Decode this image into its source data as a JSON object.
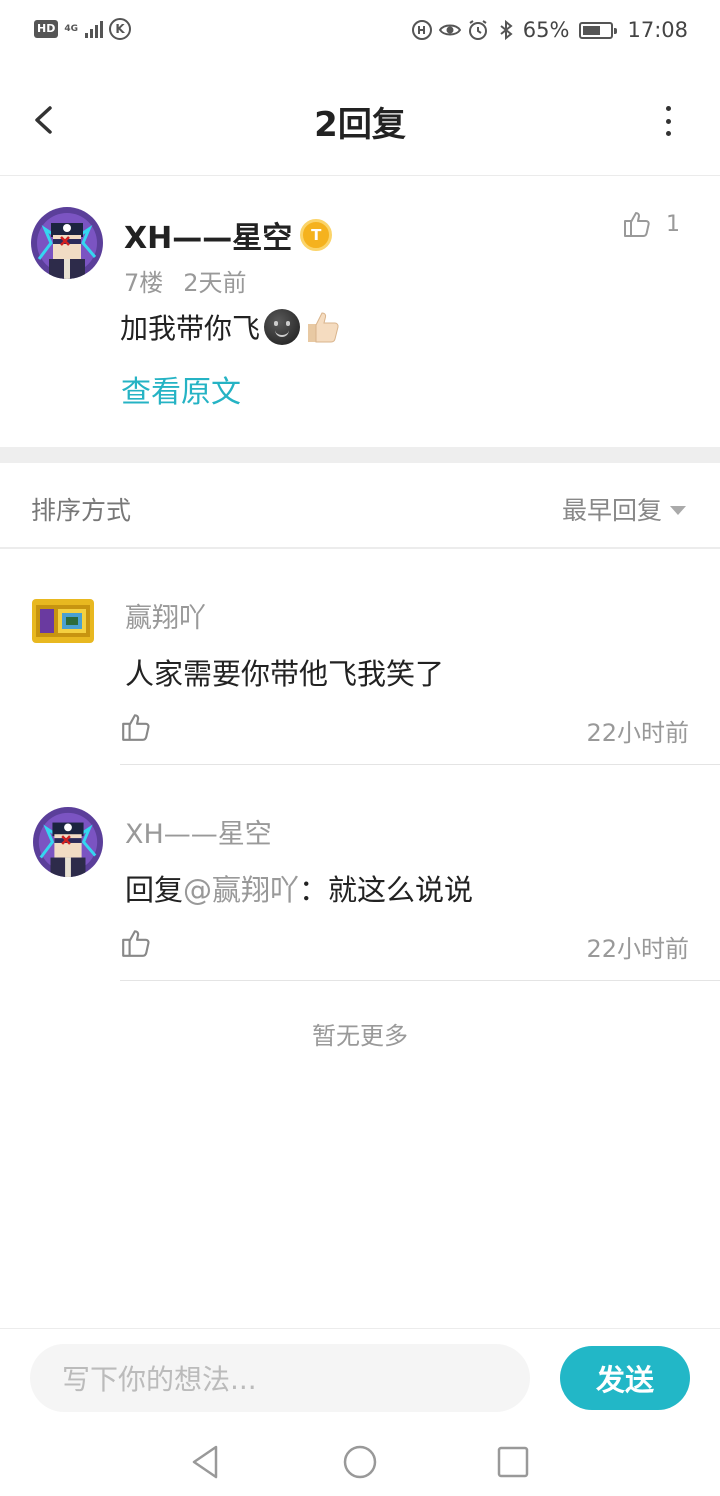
{
  "status_bar": {
    "hd": "HD",
    "network": "4G",
    "battery_percent": "65%",
    "battery_level": 0.65,
    "time": "17:08"
  },
  "header": {
    "title": "2回复",
    "back_icon": "chevron-left-icon",
    "more_icon": "more-vertical-icon"
  },
  "original_post": {
    "username": "XH——星空",
    "badge": "T",
    "like_count": "1",
    "floor": "7楼",
    "time": "2天前",
    "content": "加我带你飞",
    "view_original_label": "查看原文"
  },
  "sort": {
    "label": "排序方式",
    "selected": "最早回复"
  },
  "replies": [
    {
      "username": "赢翔吖",
      "text": "人家需要你带他飞我笑了",
      "time": "22小时前"
    },
    {
      "username": "XH——星空",
      "text_prefix": "回复",
      "mention": "@赢翔吖",
      "text": "：就这么说说",
      "time": "22小时前"
    }
  ],
  "no_more_label": "暂无更多",
  "composer": {
    "placeholder": "写下你的想法...",
    "send_label": "发送"
  },
  "colors": {
    "accent": "#22b7c7",
    "link": "#25b3c4",
    "badge": "#f5b21e"
  }
}
